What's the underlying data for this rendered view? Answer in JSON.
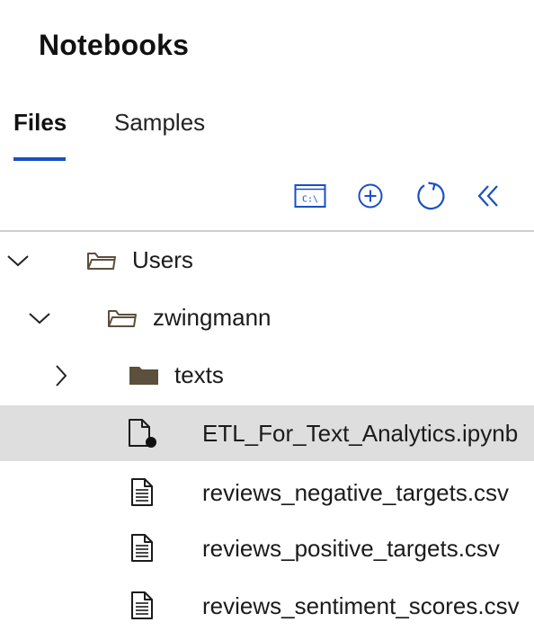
{
  "panel": {
    "title": "Notebooks"
  },
  "tabs": [
    {
      "label": "Files",
      "active": true
    },
    {
      "label": "Samples",
      "active": false
    }
  ],
  "toolbar": {
    "buttons": [
      {
        "name": "terminal",
        "icon": "terminal-icon",
        "glyph": "C:\\"
      },
      {
        "name": "create-new",
        "icon": "plus-circle-icon"
      },
      {
        "name": "refresh",
        "icon": "refresh-icon"
      },
      {
        "name": "collapse",
        "icon": "double-chevron-left-icon"
      }
    ],
    "accent_color": "#1a4fc4"
  },
  "tree": {
    "items": [
      {
        "label": "Users",
        "type": "folder",
        "expanded": true
      },
      {
        "label": "zwingmann",
        "type": "folder",
        "expanded": true
      },
      {
        "label": "texts",
        "type": "folder-filled",
        "expanded": false
      },
      {
        "label": "ETL_For_Text_Analytics.ipynb",
        "type": "notebook",
        "selected": true
      },
      {
        "label": "reviews_negative_targets.csv",
        "type": "file"
      },
      {
        "label": "reviews_positive_targets.csv",
        "type": "file"
      },
      {
        "label": "reviews_sentiment_scores.csv",
        "type": "file"
      }
    ]
  },
  "colors": {
    "folder_fill": "#5c4f3b",
    "selected_bg": "#dedede"
  }
}
